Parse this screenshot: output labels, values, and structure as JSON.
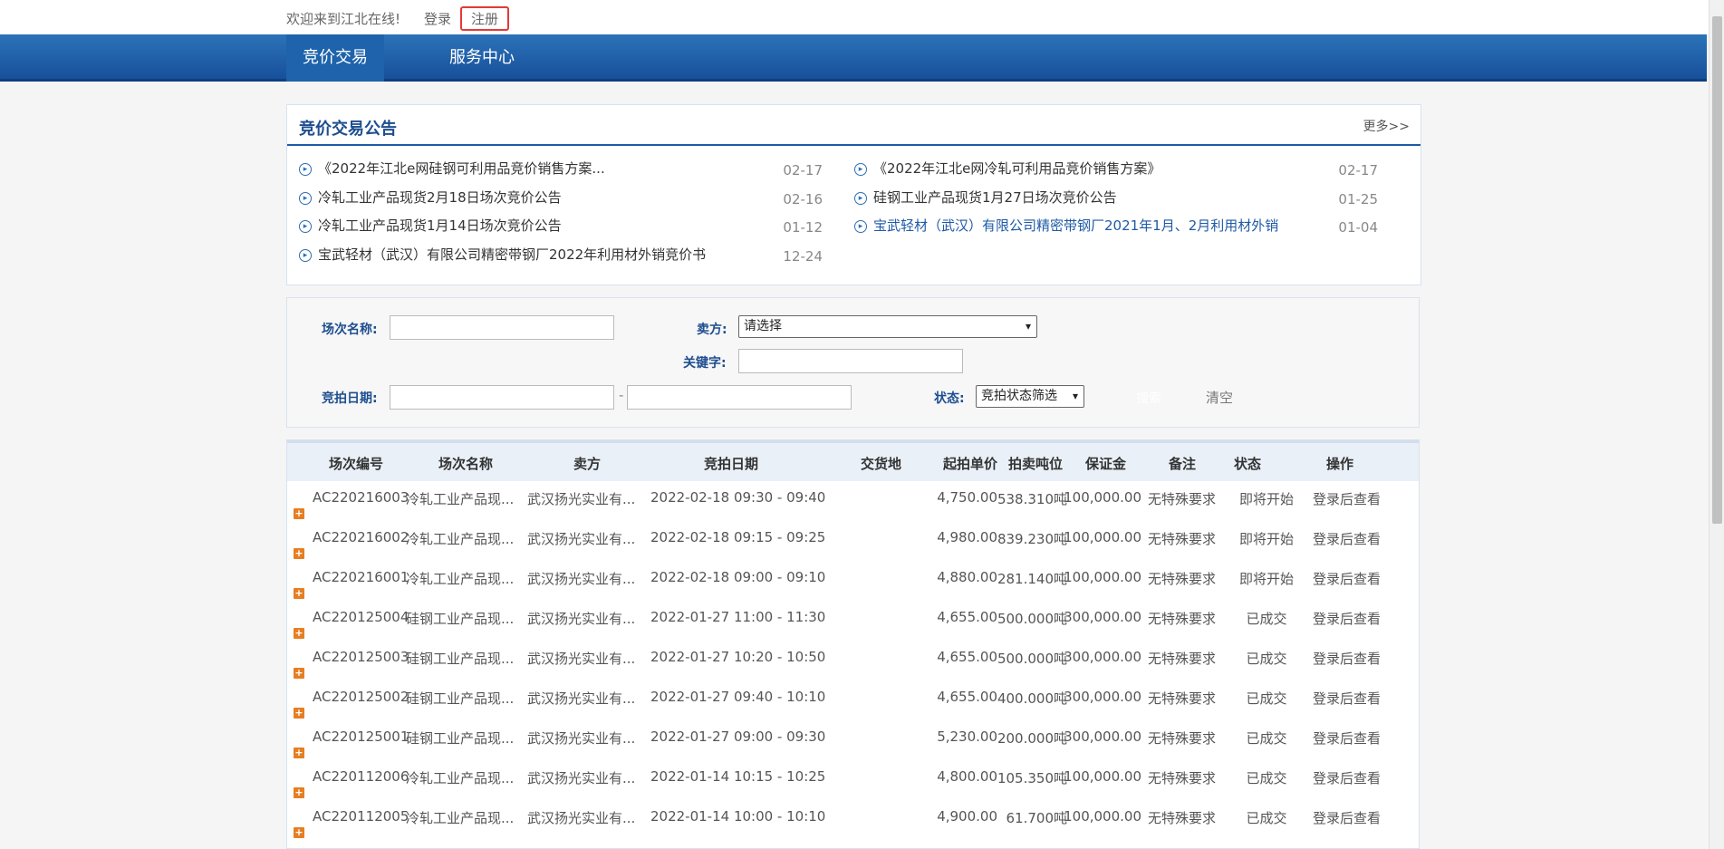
{
  "topbar": {
    "welcome": "欢迎来到江北在线!",
    "login": "登录",
    "register": "注册"
  },
  "nav": {
    "tabs": [
      "竞价交易",
      "服务中心"
    ]
  },
  "announcements": {
    "title": "竞价交易公告",
    "more": "更多>>",
    "left": [
      {
        "text": "《2022年江北e网硅钢可利用品竞价销售方案...",
        "date": "02-17"
      },
      {
        "text": "冷轧工业产品现货2月18日场次竞价公告",
        "date": "02-16"
      },
      {
        "text": "冷轧工业产品现货1月14日场次竞价公告",
        "date": "01-12"
      },
      {
        "text": "宝武轻材（武汉）有限公司精密带钢厂2022年利用材外销竞价书",
        "date": "12-24"
      }
    ],
    "right": [
      {
        "text": "《2022年江北e网冷轧可利用品竞价销售方案》",
        "date": "02-17"
      },
      {
        "text": "硅钢工业产品现货1月27日场次竞价公告",
        "date": "01-25"
      },
      {
        "text": "宝武轻材（武汉）有限公司精密带钢厂2021年1月、2月利用材外销",
        "date": "01-04"
      }
    ]
  },
  "search": {
    "session_name_label": "场次名称:",
    "seller_label": "卖方:",
    "seller_value": "请选择",
    "keyword_label": "关键字:",
    "date_label": "竞拍日期:",
    "date_sep": "-",
    "status_label": "状态:",
    "status_value": "竞拍状态筛选",
    "search_btn": "搜索",
    "clear_btn": "清空"
  },
  "table": {
    "headers": [
      "场次编号",
      "场次名称",
      "卖方",
      "竞拍日期",
      "交货地",
      "起拍单价",
      "拍卖吨位",
      "保证金",
      "备注",
      "状态",
      "操作"
    ],
    "rows": [
      [
        "AC220216003",
        "冷轧工业产品现...",
        "武汉扬光实业有...",
        "2022-02-18 09:30 - 09:40",
        "",
        "4,750.00",
        "538.310吨",
        "100,000.00",
        "无特殊要求",
        "即将开始",
        "登录后查看"
      ],
      [
        "AC220216002",
        "冷轧工业产品现...",
        "武汉扬光实业有...",
        "2022-02-18 09:15 - 09:25",
        "",
        "4,980.00",
        "839.230吨",
        "100,000.00",
        "无特殊要求",
        "即将开始",
        "登录后查看"
      ],
      [
        "AC220216001",
        "冷轧工业产品现...",
        "武汉扬光实业有...",
        "2022-02-18 09:00 - 09:10",
        "",
        "4,880.00",
        "281.140吨",
        "100,000.00",
        "无特殊要求",
        "即将开始",
        "登录后查看"
      ],
      [
        "AC220125004",
        "硅钢工业产品现...",
        "武汉扬光实业有...",
        "2022-01-27 11:00 - 11:30",
        "",
        "4,655.00",
        "500.000吨",
        "300,000.00",
        "无特殊要求",
        "已成交",
        "登录后查看"
      ],
      [
        "AC220125003",
        "硅钢工业产品现...",
        "武汉扬光实业有...",
        "2022-01-27 10:20 - 10:50",
        "",
        "4,655.00",
        "500.000吨",
        "300,000.00",
        "无特殊要求",
        "已成交",
        "登录后查看"
      ],
      [
        "AC220125002",
        "硅钢工业产品现...",
        "武汉扬光实业有...",
        "2022-01-27 09:40 - 10:10",
        "",
        "4,655.00",
        "400.000吨",
        "300,000.00",
        "无特殊要求",
        "已成交",
        "登录后查看"
      ],
      [
        "AC220125001",
        "硅钢工业产品现...",
        "武汉扬光实业有...",
        "2022-01-27 09:00 - 09:30",
        "",
        "5,230.00",
        "200.000吨",
        "300,000.00",
        "无特殊要求",
        "已成交",
        "登录后查看"
      ],
      [
        "AC220112006",
        "冷轧工业产品现...",
        "武汉扬光实业有...",
        "2022-01-14 10:15 - 10:25",
        "",
        "4,800.00",
        "105.350吨",
        "100,000.00",
        "无特殊要求",
        "已成交",
        "登录后查看"
      ],
      [
        "AC220112005",
        "冷轧工业产品现...",
        "武汉扬光实业有...",
        "2022-01-14 10:00 - 10:10",
        "",
        "4,900.00",
        "61.700吨",
        "100,000.00",
        "无特殊要求",
        "已成交",
        "登录后查看"
      ]
    ]
  }
}
